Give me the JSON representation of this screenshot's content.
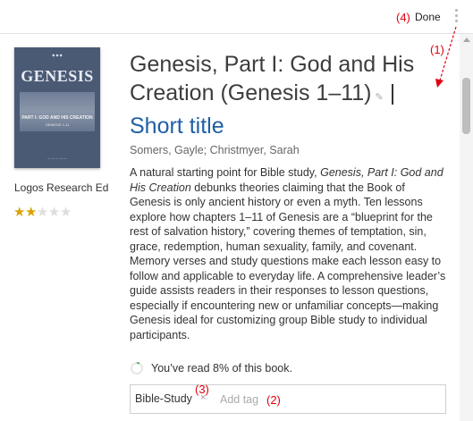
{
  "toolbar": {
    "annotation_4": "(4)",
    "done_label": "Done",
    "more_icon": "vertical-ellipsis-icon"
  },
  "book": {
    "cover": {
      "title": "GENESIS",
      "subtitle": "PART I: GOD AND HIS CREATION",
      "subtitle2": "GENESIS 1-11"
    },
    "publisher": "Logos Research Ed",
    "rating": 2,
    "rating_max": 5,
    "title_line1": "Genesis, Part I: God and His",
    "title_line2": "Creation (Genesis 1–11)",
    "title_separator": "|",
    "short_title_label": "Short title",
    "authors": "Somers, Gayle; Christmyer, Sarah",
    "description_1": "A natural starting point for Bible study, ",
    "description_em": "Genesis, Part I: God and His Creation",
    "description_2": " debunks theories claiming that the Book of Genesis is only ancient history or even a myth. Ten lessons explore how chapters 1–11 of Genesis are a “blueprint for the rest of salvation history,” covering themes of temptation, sin, grace, redemption, human sexuality, family, and covenant. Memory verses and study questions make each lesson easy to follow and applicable to everyday life. A comprehensive leader’s guide assists readers in their responses to lesson questions, especially if encountering new or unfamiliar concepts—making Genesis ideal for customizing group Bible study to individual participants.",
    "progress_percent": 8,
    "progress_text": "You’ve read 8% of this book."
  },
  "tags": {
    "items": [
      "Bible-Study"
    ],
    "remove_glyph": "×",
    "placeholder": "Add tag"
  },
  "annotations": {
    "a1": "(1)",
    "a2": "(2)",
    "a3": "(3)",
    "color": "#e0000f"
  }
}
